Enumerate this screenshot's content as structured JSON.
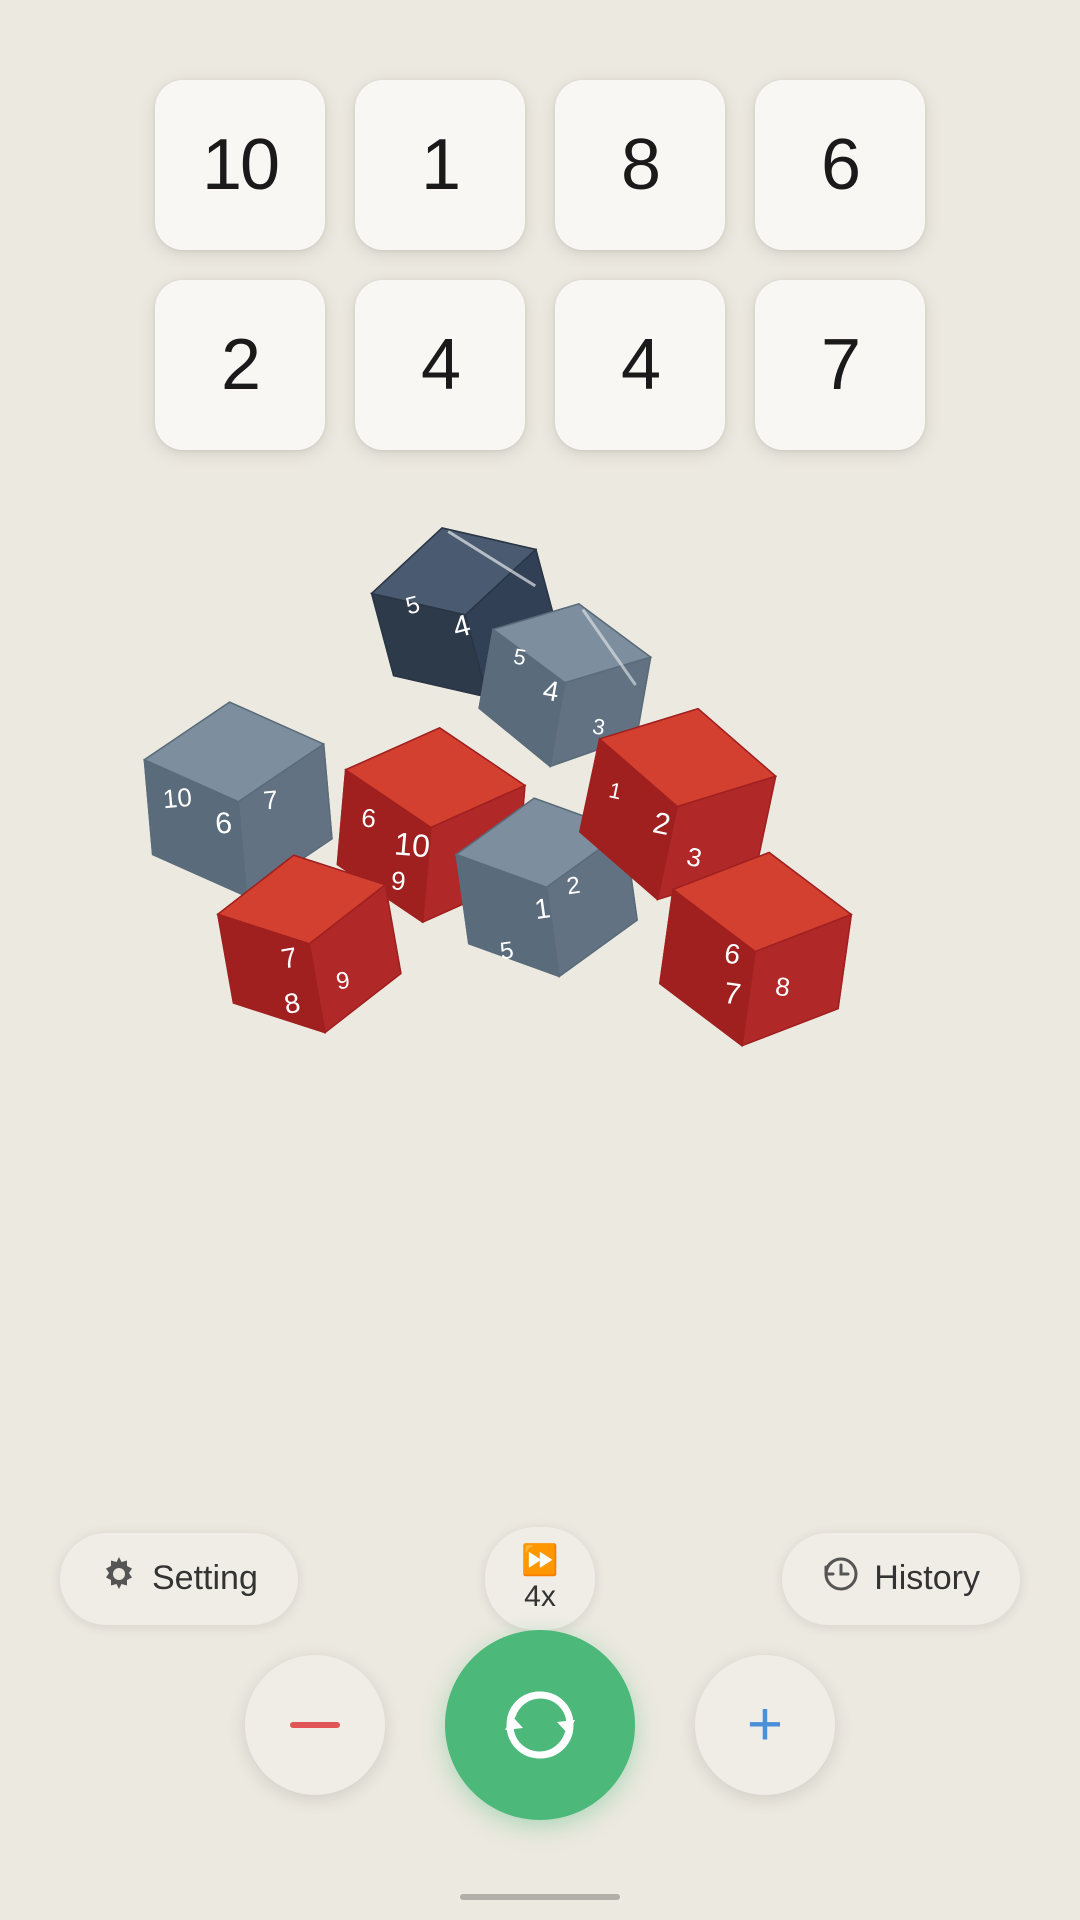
{
  "results": {
    "row1": [
      {
        "value": "10",
        "id": "r1c1"
      },
      {
        "value": "1",
        "id": "r1c2"
      },
      {
        "value": "8",
        "id": "r1c3"
      },
      {
        "value": "6",
        "id": "r1c4"
      }
    ],
    "row2": [
      {
        "value": "2",
        "id": "r2c1"
      },
      {
        "value": "4",
        "id": "r2c2"
      },
      {
        "value": "4",
        "id": "r2c3"
      },
      {
        "value": "7",
        "id": "r2c4"
      }
    ]
  },
  "toolbar": {
    "setting_label": "Setting",
    "history_label": "History",
    "speed_value": "4x"
  },
  "actions": {
    "minus_label": "−",
    "plus_label": "+"
  },
  "dice": {
    "colors": {
      "dark_gray": "#3d4a5c",
      "slate": "#7a8a9a",
      "red": "#c0392b"
    }
  }
}
